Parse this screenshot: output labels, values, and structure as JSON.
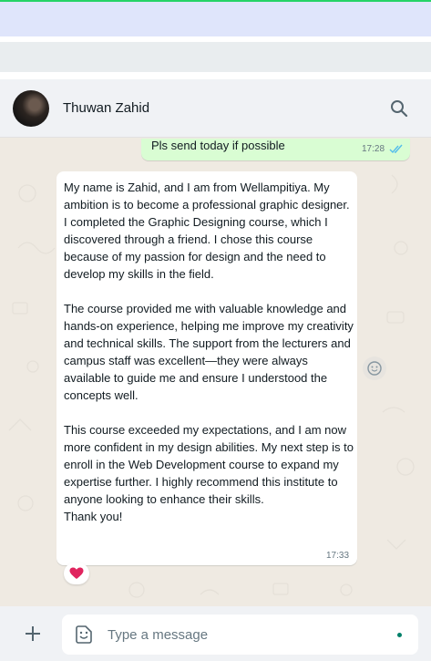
{
  "colors": {
    "accent": "#25d366",
    "outgoing_bubble": "#d9fdd3",
    "incoming_bubble": "#ffffff",
    "chat_background": "#efeae2",
    "read_ticks": "#53bdeb",
    "heart": "#e0245e"
  },
  "header": {
    "contact_name": "Thuwan Zahid",
    "search_icon": "search-icon"
  },
  "messages": {
    "outgoing": {
      "text": "Pls send today if possible",
      "time": "17:28",
      "status": "read"
    },
    "incoming": {
      "paragraphs": [
        "My name is Zahid, and I am from Wellampitiya. My ambition is to become a professional graphic designer. I completed the Graphic Designing course, which I discovered through a friend. I chose this course because of my passion for design and the need to develop my skills in the field.",
        "The course provided me with valuable knowledge and hands-on experience, helping me improve my creativity and technical skills. The support from the lecturers and campus staff was excellent—they were always available to guide me and ensure I understood the concepts well.",
        "This course exceeded my expectations, and I am now more confident in my design abilities. My next step is to enroll in the Web Development course to expand my expertise further. I highly recommend this institute to anyone looking to enhance their skills.",
        "Thank you!"
      ],
      "time": "17:33",
      "reaction": "heart-icon"
    }
  },
  "composer": {
    "placeholder": "Type a message",
    "attach_icon": "plus-icon",
    "emoji_icon": "emoji-icon"
  }
}
